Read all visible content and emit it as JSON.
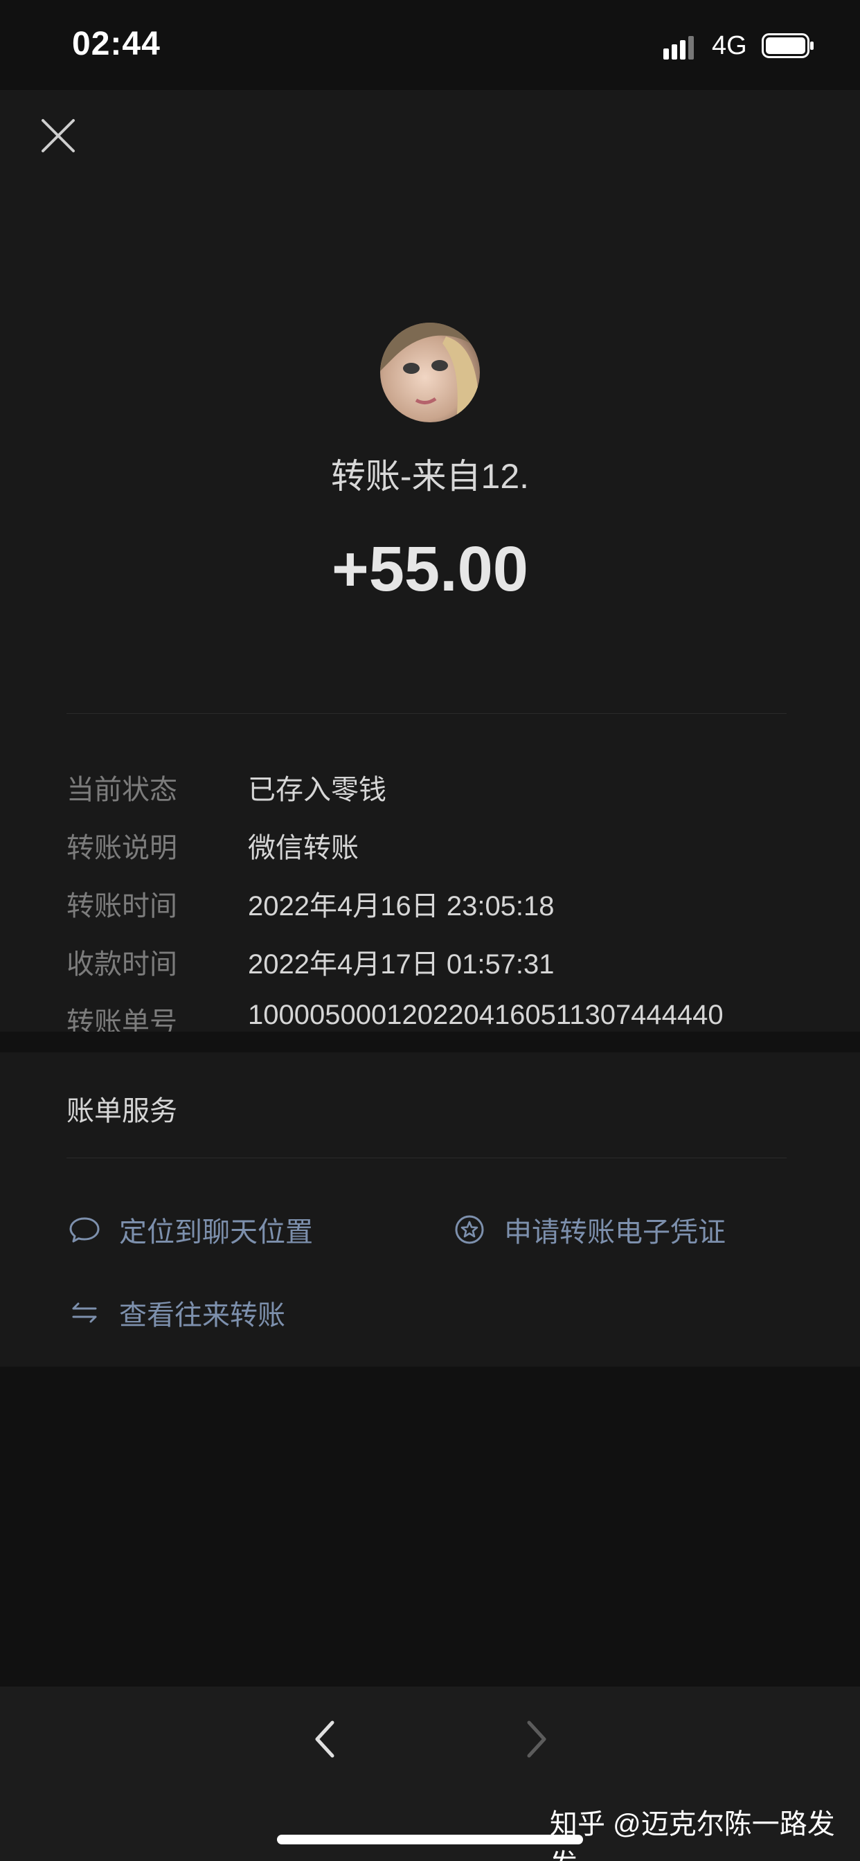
{
  "status_bar": {
    "time": "02:44",
    "network": "4G"
  },
  "header": {
    "title": "转账-来自12.",
    "amount": "+55.00"
  },
  "details": [
    {
      "label": "当前状态",
      "value": "已存入零钱"
    },
    {
      "label": "转账说明",
      "value": "微信转账"
    },
    {
      "label": "转账时间",
      "value": "2022年4月16日 23:05:18"
    },
    {
      "label": "收款时间",
      "value": "2022年4月17日 01:57:31"
    },
    {
      "label": "转账单号",
      "value": "1000050001202204160511307444440"
    }
  ],
  "services": {
    "title": "账单服务",
    "items": [
      {
        "label": "定位到聊天位置",
        "icon": "chat-bubble-icon"
      },
      {
        "label": "申请转账电子凭证",
        "icon": "star-badge-icon"
      },
      {
        "label": "查看往来转账",
        "icon": "swap-arrows-icon"
      }
    ],
    "link_color": "#7d90ad"
  },
  "watermark": "知乎 @迈克尔陈一路发发",
  "colors": {
    "background": "#111111",
    "panel": "#191919",
    "label": "#7c7c7c",
    "value": "#d6d6d6"
  }
}
